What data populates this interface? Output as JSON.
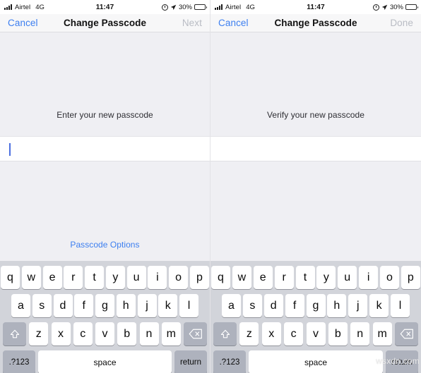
{
  "status_bar": {
    "carrier": "Airtel",
    "network": "4G",
    "time": "11:47",
    "battery_percent": "30%",
    "icons": [
      "signal-bars-icon",
      "alarm-clock-icon",
      "location-arrow-icon",
      "battery-icon"
    ]
  },
  "panels": [
    {
      "id": "left",
      "nav": {
        "left_button": "Cancel",
        "title": "Change Passcode",
        "right_button": "Next",
        "right_disabled": true
      },
      "prompt": "Enter your new passcode",
      "field_value": "",
      "caret_visible": true,
      "passcode_options": "Passcode Options",
      "show_passcode_options": true
    },
    {
      "id": "right",
      "nav": {
        "left_button": "Cancel",
        "title": "Change Passcode",
        "right_button": "Done",
        "right_disabled": true
      },
      "prompt": "Verify your new passcode",
      "field_value": "",
      "caret_visible": false,
      "passcode_options": "",
      "show_passcode_options": false
    }
  ],
  "keyboard": {
    "row1": [
      "q",
      "w",
      "e",
      "r",
      "t",
      "y",
      "u",
      "i",
      "o",
      "p"
    ],
    "row2": [
      "a",
      "s",
      "d",
      "f",
      "g",
      "h",
      "j",
      "k",
      "l"
    ],
    "row3": [
      "z",
      "x",
      "c",
      "v",
      "b",
      "n",
      "m"
    ],
    "shift_key": "shift-icon",
    "delete_key": "delete-icon",
    "numeric_key": ".?123",
    "space_key": "space",
    "return_key": "return"
  },
  "watermark": "wsxdn.com",
  "colors": {
    "accent_blue": "#3d7ff0",
    "disabled_gray": "#b9bcc4",
    "content_bg": "#efeff3",
    "keyboard_bg": "#d2d4da",
    "key_white": "#ffffff",
    "key_dark": "#aeb2bd",
    "caret_blue": "#4b6fe0"
  }
}
